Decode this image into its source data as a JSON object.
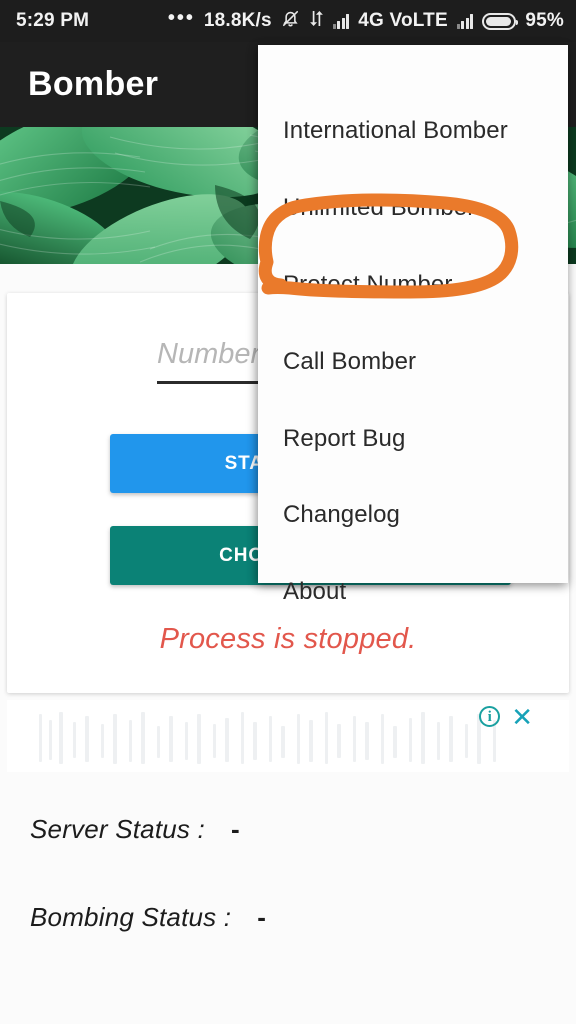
{
  "status_bar": {
    "clock": "5:29 PM",
    "overflow_dots": "•••",
    "network_speed": "18.8K/s",
    "mute_icon": "bell-muted-icon",
    "data_transfer_icon": "data-transfer-arrows-icon",
    "signal_icon_1": "signal-bars-icon",
    "network_type": "4G VoLTE",
    "signal_icon_2": "signal-bars-icon",
    "battery_icon": "battery-icon",
    "battery_percent": "95%"
  },
  "app_bar": {
    "title": "Bomber"
  },
  "banner": {
    "alt": "green-leaves-photo"
  },
  "main_card": {
    "number_input": {
      "value": "",
      "placeholder": "Number"
    },
    "start_process_label": "START PROCESS",
    "choose_number_label": "CHOOSE NUMBER",
    "process_status": "Process is stopped."
  },
  "ad_banner": {
    "info_icon": "ad-choices-info-icon",
    "info_glyph": "i",
    "close_icon": "close-icon",
    "close_glyph": "✕"
  },
  "status_rows": [
    {
      "label": "Server Status :",
      "value": "-"
    },
    {
      "label": "Bombing Status :",
      "value": "-"
    }
  ],
  "overflow_menu": {
    "items": [
      {
        "label": "International Bomber"
      },
      {
        "label": "Unlimited Bomber"
      },
      {
        "label": "Protect Number"
      },
      {
        "label": "Call Bomber"
      },
      {
        "label": "Report Bug"
      },
      {
        "label": "Changelog"
      },
      {
        "label": "About"
      }
    ]
  },
  "annotation": {
    "shape": "hand-drawn-ellipse",
    "target": "Protect Number",
    "color": "#EA7A2B"
  },
  "colors": {
    "status_bar_bg": "#1d1d1d",
    "app_bar_bg": "#1f1f1f",
    "start_button": "#2196EC",
    "choose_button": "#0B8276",
    "error_text": "#E2574C",
    "annotation_orange": "#EA7A2B",
    "ad_teal": "#17A2B8"
  }
}
